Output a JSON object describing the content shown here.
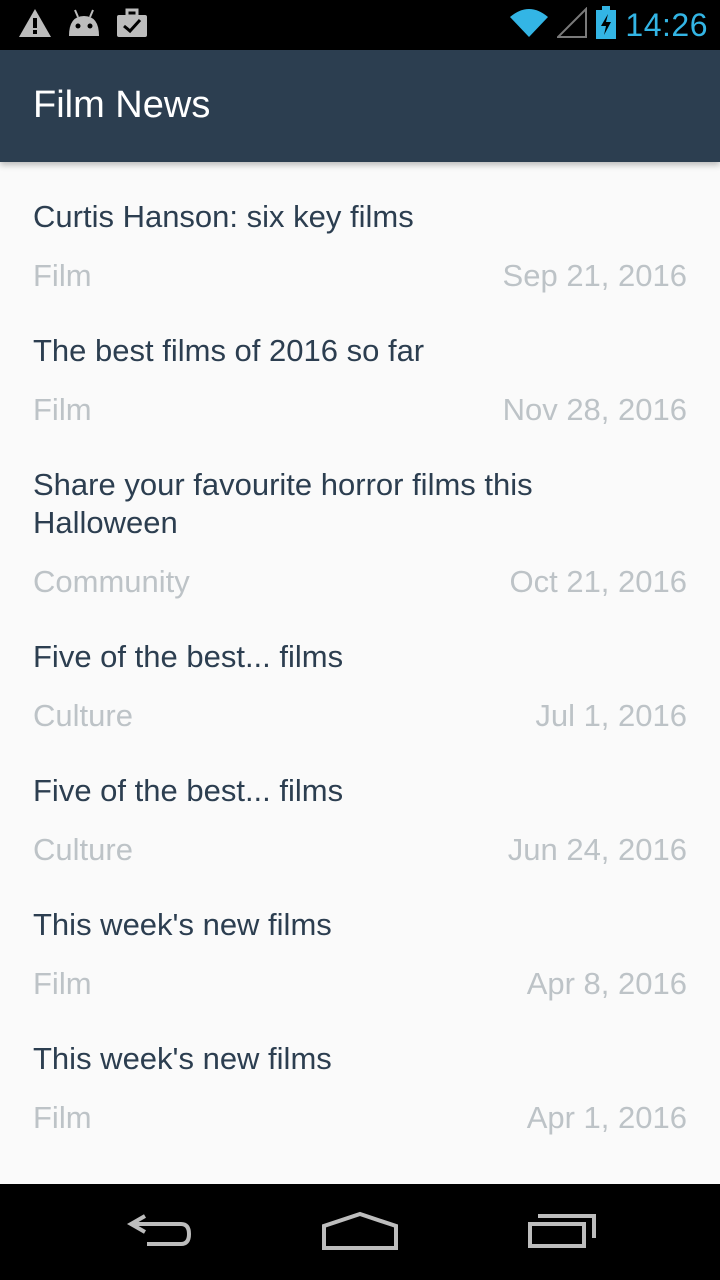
{
  "status_bar": {
    "time": "14:26",
    "icons": [
      "warning-icon",
      "android-icon",
      "briefcase-icon",
      "wifi-icon",
      "signal-icon",
      "battery-icon"
    ],
    "accent": "#33b5e5"
  },
  "app_bar": {
    "title": "Film News",
    "background": "#2c3e50"
  },
  "articles": [
    {
      "title": "Curtis Hanson: six key films",
      "section": "Film",
      "date": "Sep 21, 2016"
    },
    {
      "title": "The best films of 2016 so far",
      "section": "Film",
      "date": "Nov 28, 2016"
    },
    {
      "title": "Share your favourite horror films this Halloween",
      "section": "Community",
      "date": "Oct 21, 2016"
    },
    {
      "title": "Five of the best... films",
      "section": "Culture",
      "date": "Jul 1, 2016"
    },
    {
      "title": "Five of the best... films",
      "section": "Culture",
      "date": "Jun 24, 2016"
    },
    {
      "title": "This week's new films",
      "section": "Film",
      "date": "Apr 8, 2016"
    },
    {
      "title": "This week's new films",
      "section": "Film",
      "date": "Apr 1, 2016"
    }
  ],
  "nav_bar": {
    "icons": [
      "back-icon",
      "home-icon",
      "recents-icon"
    ]
  },
  "colors": {
    "title_text": "#2c3e50",
    "meta_text": "#bdc3c7",
    "list_background": "#fafafa"
  }
}
